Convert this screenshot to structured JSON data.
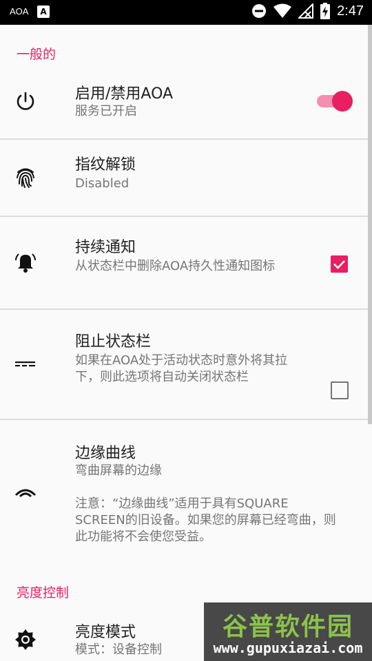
{
  "status_bar": {
    "carrier": "AOA",
    "badge": "A",
    "time": "2:47"
  },
  "sections": {
    "general": "一般的",
    "brightness": "亮度控制"
  },
  "prefs": {
    "toggle": {
      "title": "启用/禁用AOA",
      "summary": "服务已开启",
      "enabled": true
    },
    "fingerprint": {
      "title": "指纹解锁",
      "summary": "Disabled"
    },
    "notification": {
      "title": "持续通知",
      "summary": "从状态栏中删除AOA持久性通知图标",
      "checked": true
    },
    "block_statusbar": {
      "title": "阻止状态栏",
      "summary": "如果在AOA处于活动状态时意外将其拉下，则此选项将自动关闭状态栏",
      "checked": false
    },
    "edge_curve": {
      "title": "边缘曲线",
      "summary": "弯曲屏幕的边缘",
      "note": "注意：“边缘曲线”适用于具有SQUARE SCREEN的旧设备。如果您的屏幕已经弯曲，则此功能将不会使您受益。"
    },
    "brightness_mode": {
      "title": "亮度模式",
      "summary": "模式：设备控制"
    }
  },
  "watermark": {
    "line1": "谷普软件园",
    "line2": "www.gupuxiazai.com"
  },
  "colors": {
    "accent": "#e91e63",
    "accent_light": "#f48fb1"
  }
}
